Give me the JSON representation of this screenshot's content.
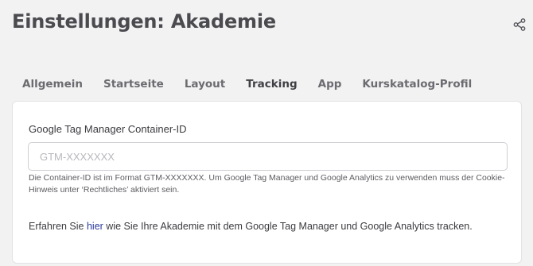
{
  "header": {
    "title": "Einstellungen: Akademie",
    "share_icon": "share-icon"
  },
  "tabs": [
    {
      "label": "Allgemein",
      "active": false
    },
    {
      "label": "Startseite",
      "active": false
    },
    {
      "label": "Layout",
      "active": false
    },
    {
      "label": "Tracking",
      "active": true
    },
    {
      "label": "App",
      "active": false
    },
    {
      "label": "Kurskatalog-Profil",
      "active": false
    }
  ],
  "tracking": {
    "field_label": "Google Tag Manager Container-ID",
    "input_value": "",
    "input_placeholder": "GTM-XXXXXXX",
    "help_text": "Die Container-ID ist im Format GTM-XXXXXXX. Um Google Tag Manager und Google Analytics zu verwenden muss der Cookie-Hinweis unter ‘Rechtliches’ aktiviert sein.",
    "info_prefix": "Erfahren Sie ",
    "info_link": "hier",
    "info_suffix": " wie Sie Ihre Akademie mit dem Google Tag Manager und Google Analytics tracken."
  },
  "colors": {
    "background": "#f2f2f3",
    "panel": "#ffffff",
    "link": "#2b3a9b"
  }
}
